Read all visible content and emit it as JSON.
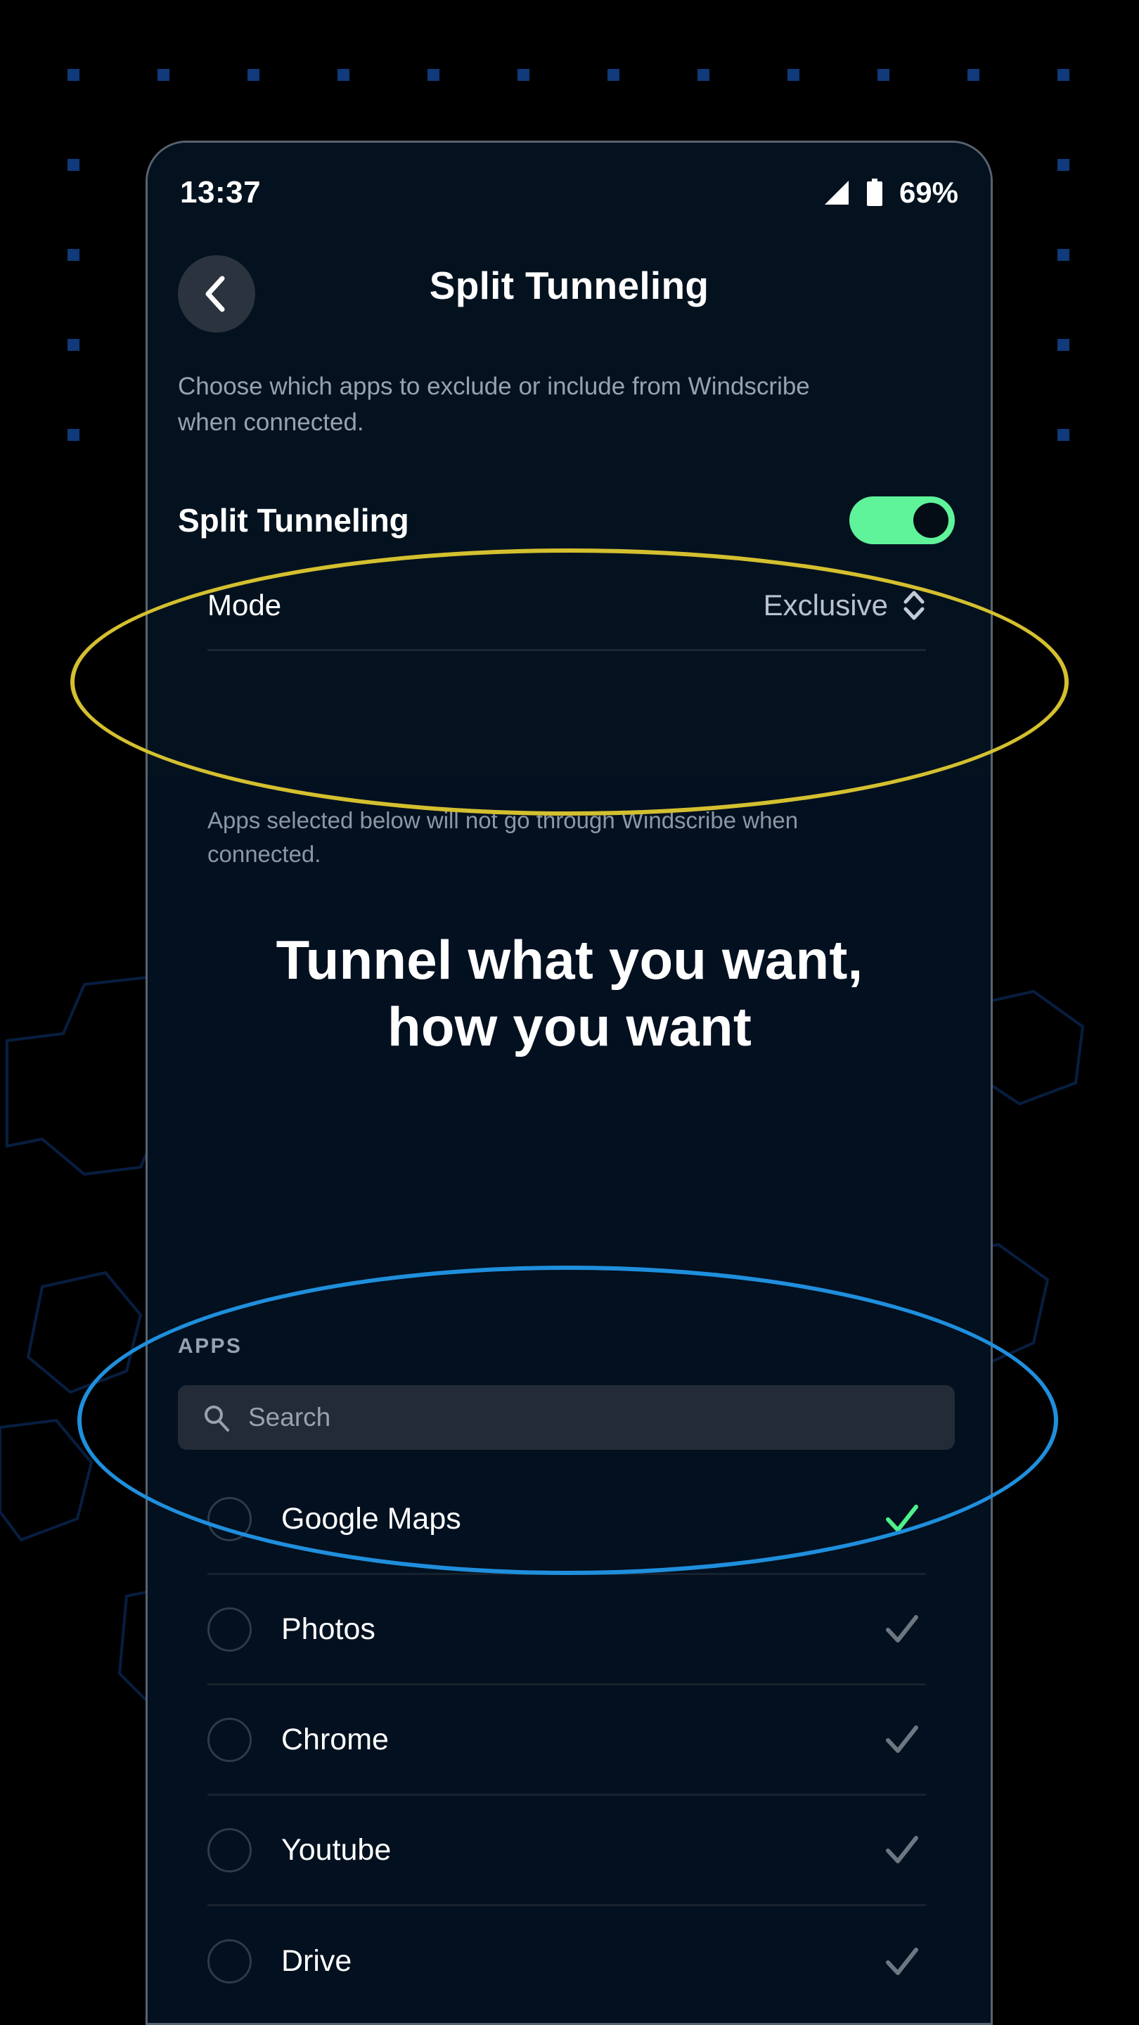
{
  "status_bar": {
    "time": "13:37",
    "battery_percent": "69%",
    "signal_icon": "signal-bars-icon",
    "battery_icon": "battery-icon"
  },
  "header": {
    "back_icon": "chevron-left-icon",
    "title": "Split Tunneling"
  },
  "description": "Choose which apps to exclude or include from Windscribe when connected.",
  "split_tunneling": {
    "label": "Split Tunneling",
    "toggle_state": "on",
    "toggle_color": "#5ff39a"
  },
  "mode": {
    "label": "Mode",
    "value": "Exclusive",
    "stepper_icon": "chevron-up-down-icon"
  },
  "helper_text": "Apps selected below will not go through Windscribe when connected.",
  "headline": {
    "line1": "Tunnel what you want,",
    "line2": "how you want"
  },
  "apps_section": {
    "header": "APPS",
    "search": {
      "placeholder": "Search",
      "value": "",
      "icon": "search-icon"
    },
    "rows": [
      {
        "name": "Google Maps",
        "selected": true,
        "check_color": "#4ef08a"
      },
      {
        "name": "Photos",
        "selected": false,
        "check_color": "#6d7782"
      },
      {
        "name": "Chrome",
        "selected": false,
        "check_color": "#6d7782"
      },
      {
        "name": "Youtube",
        "selected": false,
        "check_color": "#6d7782"
      },
      {
        "name": "Drive",
        "selected": false,
        "check_color": "#6d7782"
      }
    ]
  },
  "annotations": {
    "yellow_ellipse_color": "#d4c02f",
    "blue_ellipse_color": "#1f8fdd"
  },
  "theme": {
    "background": "#000000",
    "phone_surface": "#03101f",
    "accent_green": "#5ff39a",
    "dot_blue": "#103a7a",
    "muted_text": "#97a2b0"
  }
}
